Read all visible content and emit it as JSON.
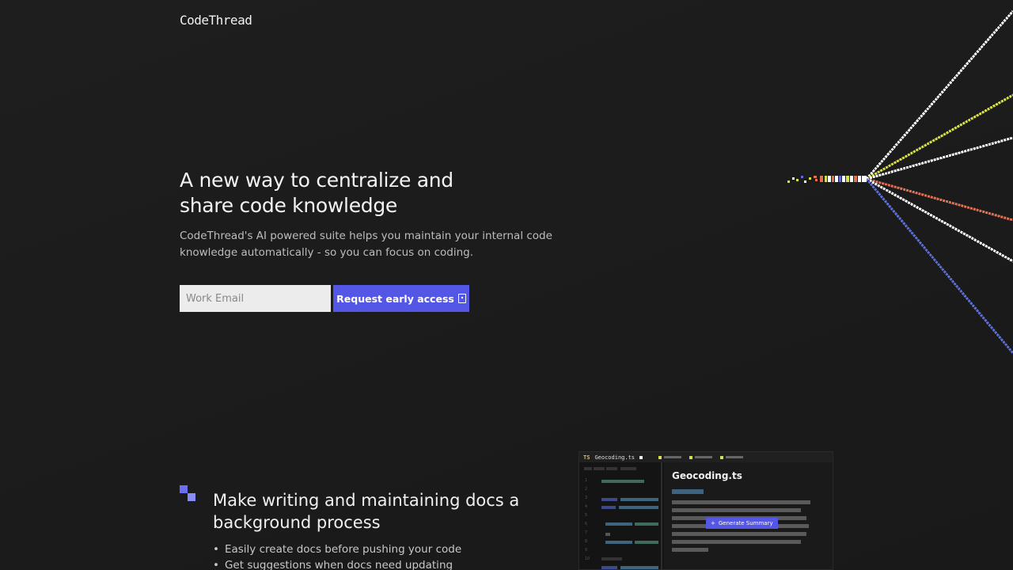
{
  "brand": {
    "logo_text": "CodeThread"
  },
  "hero": {
    "title": "A new way to centralize and share code knowledge",
    "subtitle": "CodeThread's AI powered suite helps you maintain your internal code knowledge automatically - so you can focus on coding.",
    "email_placeholder": "Work Email",
    "cta_label": "Request early access"
  },
  "feature": {
    "title": "Make writing and maintaining docs a background process",
    "bullets": [
      "Easily create docs before pushing your code",
      "Get suggestions when docs need updating"
    ]
  },
  "editor_mock": {
    "tab_badge": "TS",
    "tab_name": "Geocoding.ts",
    "doc_title": "Geocoding.ts",
    "generate_label": "Generate Summary",
    "line_numbers": [
      "1",
      "2",
      "3",
      "4",
      "5",
      "6",
      "7",
      "8",
      "9",
      "10"
    ]
  },
  "colors": {
    "accent": "#5457e6",
    "background": "#1c1c1c",
    "beam_white": "#ffffff",
    "beam_yellow": "#d8e04a",
    "beam_orange": "#e36f55",
    "beam_blue": "#5b6fd6"
  }
}
